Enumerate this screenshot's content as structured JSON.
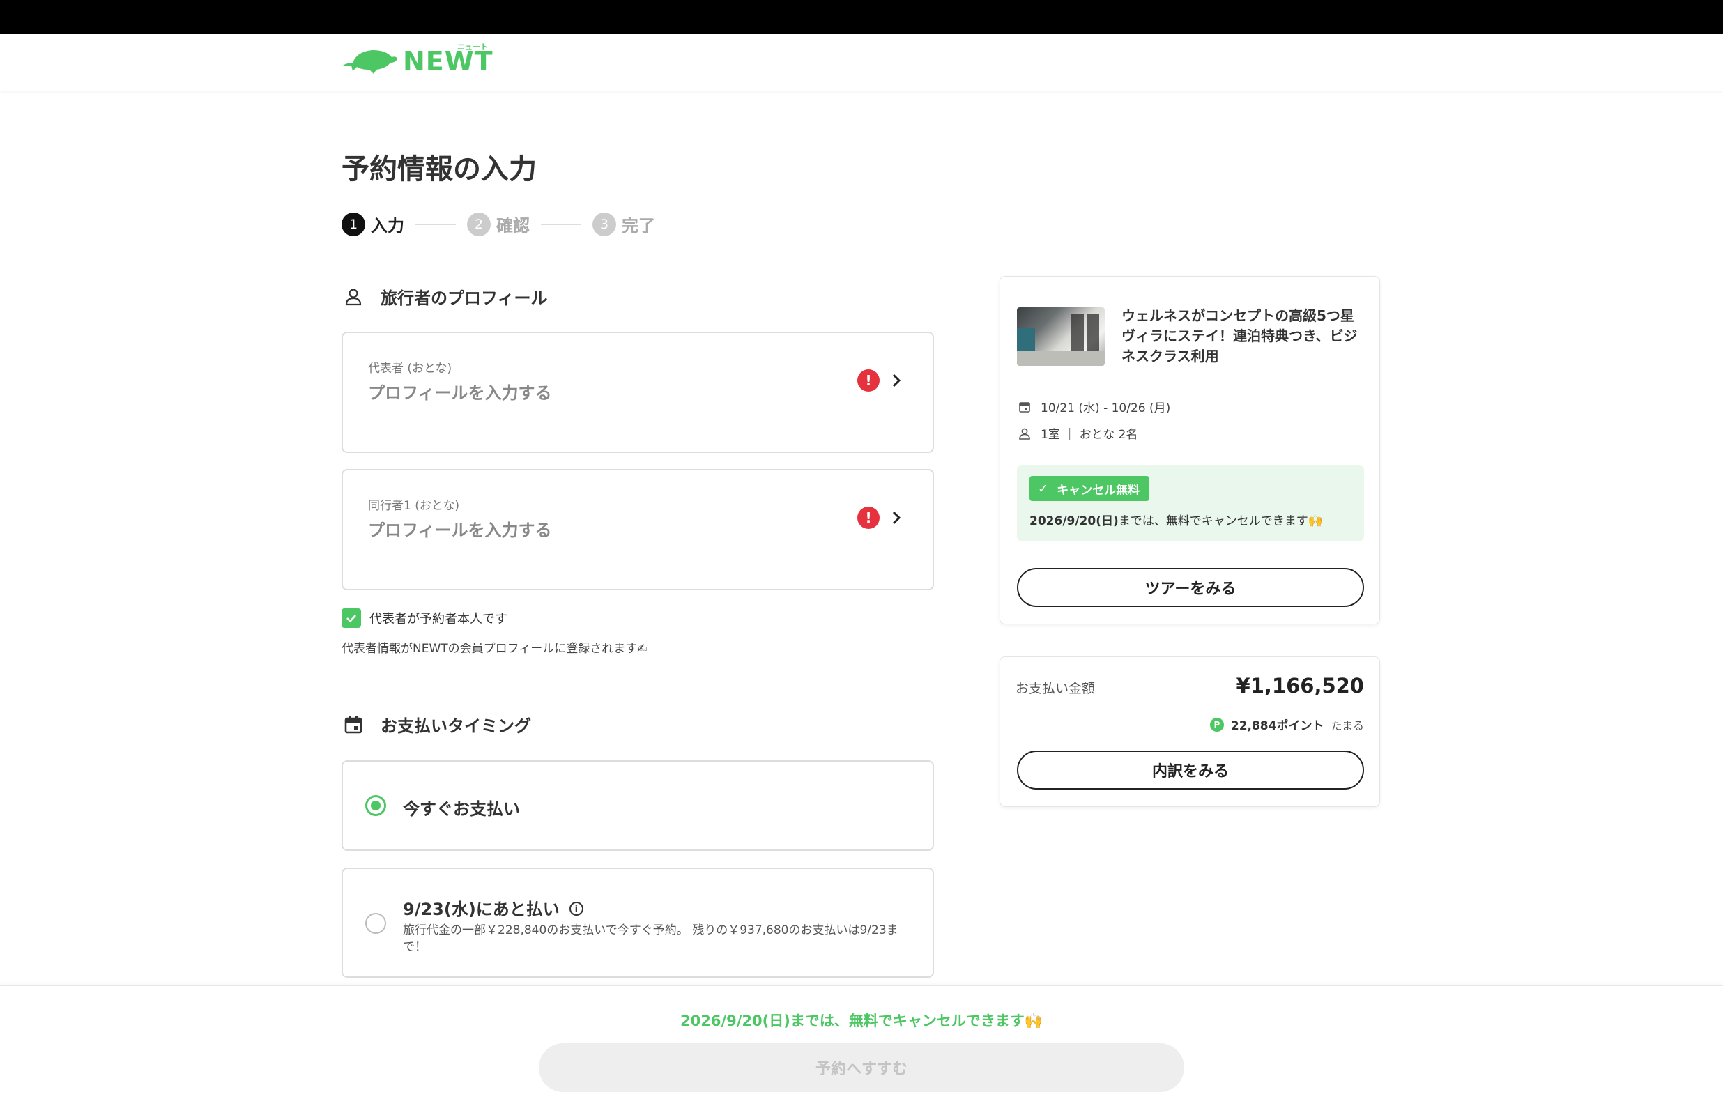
{
  "header": {
    "logo_text": "NEWT",
    "logo_ruby": "ニュート"
  },
  "page_title": "予約情報の入力",
  "steps": [
    {
      "num": "1",
      "label": "入力"
    },
    {
      "num": "2",
      "label": "確認"
    },
    {
      "num": "3",
      "label": "完了"
    }
  ],
  "profile_section": {
    "title": "旅行者のプロフィール",
    "cards": [
      {
        "role": "代表者 (おとな)",
        "prompt": "プロフィールを入力する"
      },
      {
        "role": "同行者1 (おとな)",
        "prompt": "プロフィールを入力する"
      }
    ],
    "checkbox_label": "代表者が予約者本人です",
    "note": "代表者情報がNEWTの会員プロフィールに登録されます✍"
  },
  "payment_section": {
    "title": "お支払いタイミング",
    "options": [
      {
        "title": "今すぐお支払い",
        "selected": true
      },
      {
        "title": "9/23(水)にあと払い",
        "desc": "旅行代金の一部￥228,840のお支払いで今すぐ予約。 残りの￥937,680のお支払いは9/23まで！",
        "selected": false
      }
    ]
  },
  "tour": {
    "title": "ウェルネスがコンセプトの高級5つ星ヴィラにステイ！連泊特典つき、ビジネスクラス利用",
    "dates": "10/21 (水) - 10/26 (月)",
    "guests": "1室 ｜ おとな 2名",
    "cancel_badge": "キャンセル無料",
    "cancel_date": "2026/9/20(日)",
    "cancel_text": "までは、無料でキャンセルできます🙌",
    "view_tour_button": "ツアーをみる"
  },
  "price": {
    "label": "お支払い金額",
    "value": "¥1,166,520",
    "points": "22,884ポイント",
    "points_suffix": "たまる",
    "breakdown_button": "内訳をみる"
  },
  "footer": {
    "note": "2026/9/20(日)までは、無料でキャンセルできます🙌",
    "submit_button": "予約へすすむ"
  },
  "colors": {
    "accent": "#4cc764",
    "error": "#e5323e",
    "disabled_bg": "#eeeeee"
  }
}
